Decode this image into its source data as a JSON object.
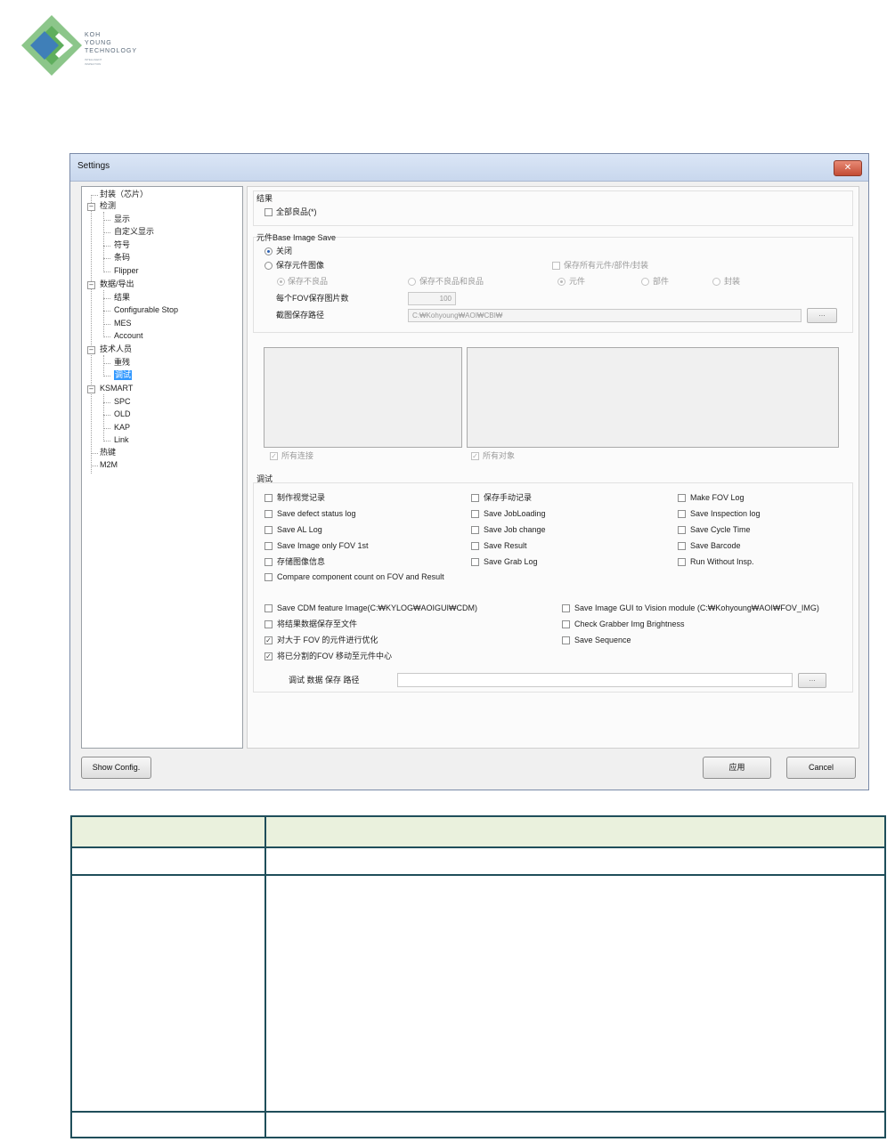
{
  "logo": {
    "line1": "KOH",
    "line2": "YOUNG",
    "line3": "TECHNOLOGY",
    "tag1": "INTELLIGENT",
    "tag2": "INSPECTION"
  },
  "window": {
    "title": "Settings",
    "close_label": "✕"
  },
  "tree": {
    "items": [
      {
        "label": "封装（芯片）"
      },
      {
        "label": "检测"
      },
      {
        "label": "显示"
      },
      {
        "label": "自定义显示"
      },
      {
        "label": "符号"
      },
      {
        "label": "条码"
      },
      {
        "label": "Flipper"
      },
      {
        "label": "数据/导出"
      },
      {
        "label": "结果"
      },
      {
        "label": "Configurable Stop"
      },
      {
        "label": "MES"
      },
      {
        "label": "Account"
      },
      {
        "label": "技术人员"
      },
      {
        "label": "重残"
      },
      {
        "label": "调试"
      },
      {
        "label": "KSMART"
      },
      {
        "label": "SPC"
      },
      {
        "label": "OLD"
      },
      {
        "label": "KAP"
      },
      {
        "label": "Link"
      },
      {
        "label": "热键"
      },
      {
        "label": "M2M"
      }
    ]
  },
  "result": {
    "header": "结果",
    "all_good": "全部良品(*)"
  },
  "base_image": {
    "header": "元件Base Image Save",
    "off": "关闭",
    "save_component_image": "保存元件图像",
    "save_all": "保存所有元件/部件/封装",
    "save_bad": "保存不良品",
    "save_bad_good": "保存不良品和良品",
    "component": "元件",
    "part": "部件",
    "package": "封装",
    "images_per_fov_label": "每个FOV保存图片数",
    "images_per_fov_value": "100",
    "path_label": "截图保存路径",
    "path_value": "C:₩Kohyoung₩AOI₩CBI₩",
    "browse": "..."
  },
  "preview": {
    "all_links": "所有连接",
    "all_objects": "所有对象"
  },
  "debug": {
    "header": "调试",
    "col1": [
      "制作视觉记录",
      "Save defect status log",
      "Save AL Log",
      "Save Image only FOV 1st",
      "存储图像信息",
      "Compare component count on FOV and Result"
    ],
    "col2": [
      "保存手动记录",
      "Save JobLoading",
      "Save Job change",
      "Save Result",
      "Save Grab Log"
    ],
    "col3": [
      "Make FOV Log",
      "Save Inspection log",
      "Save Cycle Time",
      "Save Barcode",
      "Run Without Insp."
    ],
    "lower_left": [
      "Save CDM feature Image(C:₩KYLOG₩AOIGUI₩CDM)",
      "将结果数据保存至文件",
      "对大于 FOV 的元件进行优化",
      "将已分割的FOV 移动至元件中心"
    ],
    "lower_right": [
      "Save Image GUI to Vision module (C:₩Kohyoung₩AOI₩FOV_IMG)",
      "Check Grabber Img Brightness",
      "Save Sequence"
    ],
    "path_label": "调试 数据 保存 路径",
    "path_value": "",
    "browse": "..."
  },
  "buttons": {
    "show_config": "Show Config.",
    "apply": "应用",
    "cancel": "Cancel"
  },
  "doc_table": {
    "rows": [
      [
        "",
        ""
      ],
      [
        "",
        ""
      ],
      [
        "",
        ""
      ],
      [
        "",
        ""
      ]
    ]
  }
}
